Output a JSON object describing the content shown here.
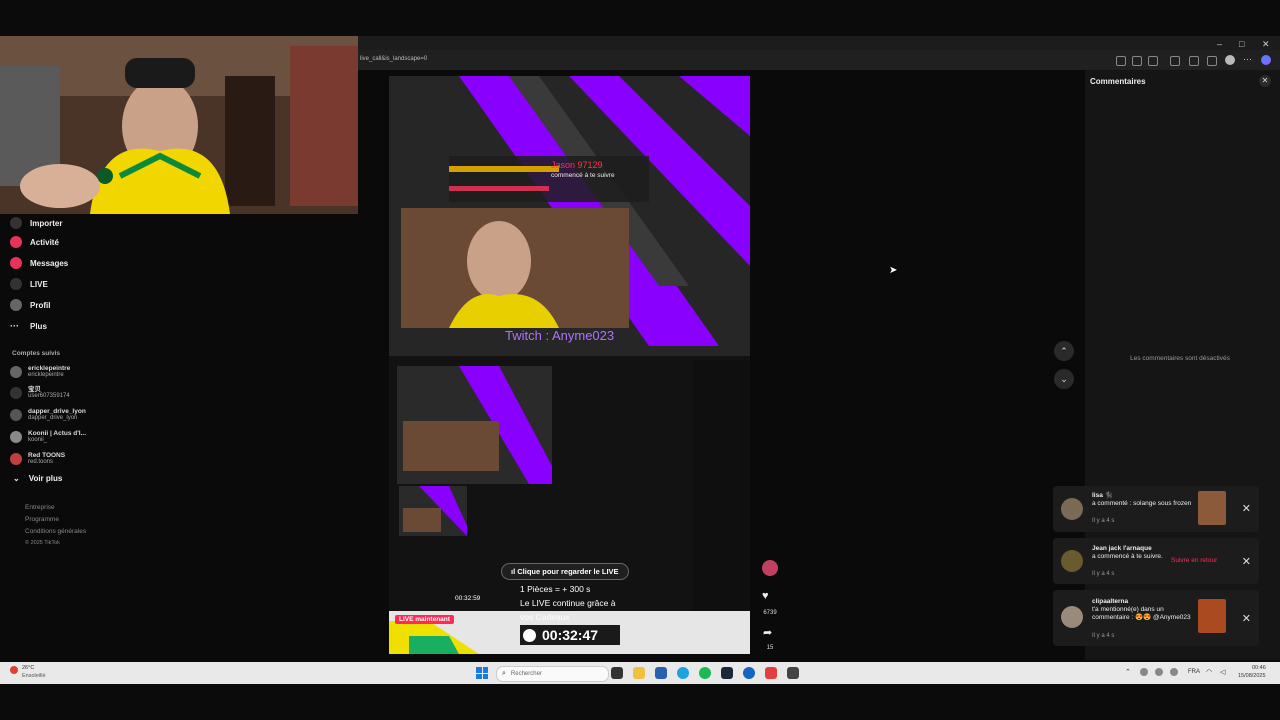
{
  "browser": {
    "url": "live_call&is_landscape=0",
    "minimize": "–",
    "maximize": "□",
    "close": "✕"
  },
  "sidebar": {
    "items": [
      {
        "label": "Importer",
        "icon": "upload-icon"
      },
      {
        "label": "Activité",
        "icon": "bell-icon"
      },
      {
        "label": "Messages",
        "icon": "message-icon"
      },
      {
        "label": "LIVE",
        "icon": "live-icon"
      },
      {
        "label": "Profil",
        "icon": "user-icon"
      },
      {
        "label": "Plus",
        "icon": "more-icon"
      }
    ],
    "following_title": "Comptes suivis",
    "following": [
      {
        "name": "ericklepeintre",
        "handle": "ericklepeintre"
      },
      {
        "name": "宝贝",
        "handle": "user607359174"
      },
      {
        "name": "dapper_drive_lyon",
        "handle": "dapper_drive_lyon"
      },
      {
        "name": "Koonii | Actus d'I...",
        "handle": "koonii_"
      },
      {
        "name": "Red TOONS",
        "handle": "red.toons"
      }
    ],
    "see_more": "Voir plus",
    "footer": [
      "Entreprise",
      "Programme",
      "Conditions générales",
      "© 2025 TikTok"
    ]
  },
  "video": {
    "overlay_name": "Jason 97129",
    "overlay_action": "commencé à te suivre",
    "twitch_label": "Twitch : Anyme023",
    "cta": "Clique pour regarder le LIVE",
    "gift_line1": "1 Pièces = + 300 s",
    "gift_line2": "Le LIVE continue grâce à",
    "gift_line3": "vos Cadeaux",
    "live_badge": "LIVE maintenant",
    "timer": "00:32:47",
    "small_timer": "00:32:59",
    "likes": "6739",
    "shares": "15"
  },
  "comments": {
    "title": "Commentaires",
    "disabled": "Les commentaires sont désactivés"
  },
  "notifications": [
    {
      "name": "lisa 🐈‍⬛",
      "text": "a commenté : solange sous frozen",
      "time": "Il y a 4 s",
      "action": ""
    },
    {
      "name": "Jean jack l'arnaque",
      "text": "a commencé à te suivre.",
      "time": "Il y a 4 s",
      "action": "Suivre en retour"
    },
    {
      "name": "clipaalterna",
      "text": "t'a mentionné(e) dans un commentaire : 😍😍 @Anyme023",
      "time": "Il y a 4 s",
      "action": ""
    }
  ],
  "taskbar": {
    "weather_temp": "26°C",
    "weather_desc": "Ensoleillé",
    "search_placeholder": "Rechercher",
    "lang": "FRA",
    "time": "00:46",
    "date": "15/08/2025"
  },
  "colors": {
    "accent": "#8a00ff",
    "tiktok_red": "#fe2c55"
  }
}
